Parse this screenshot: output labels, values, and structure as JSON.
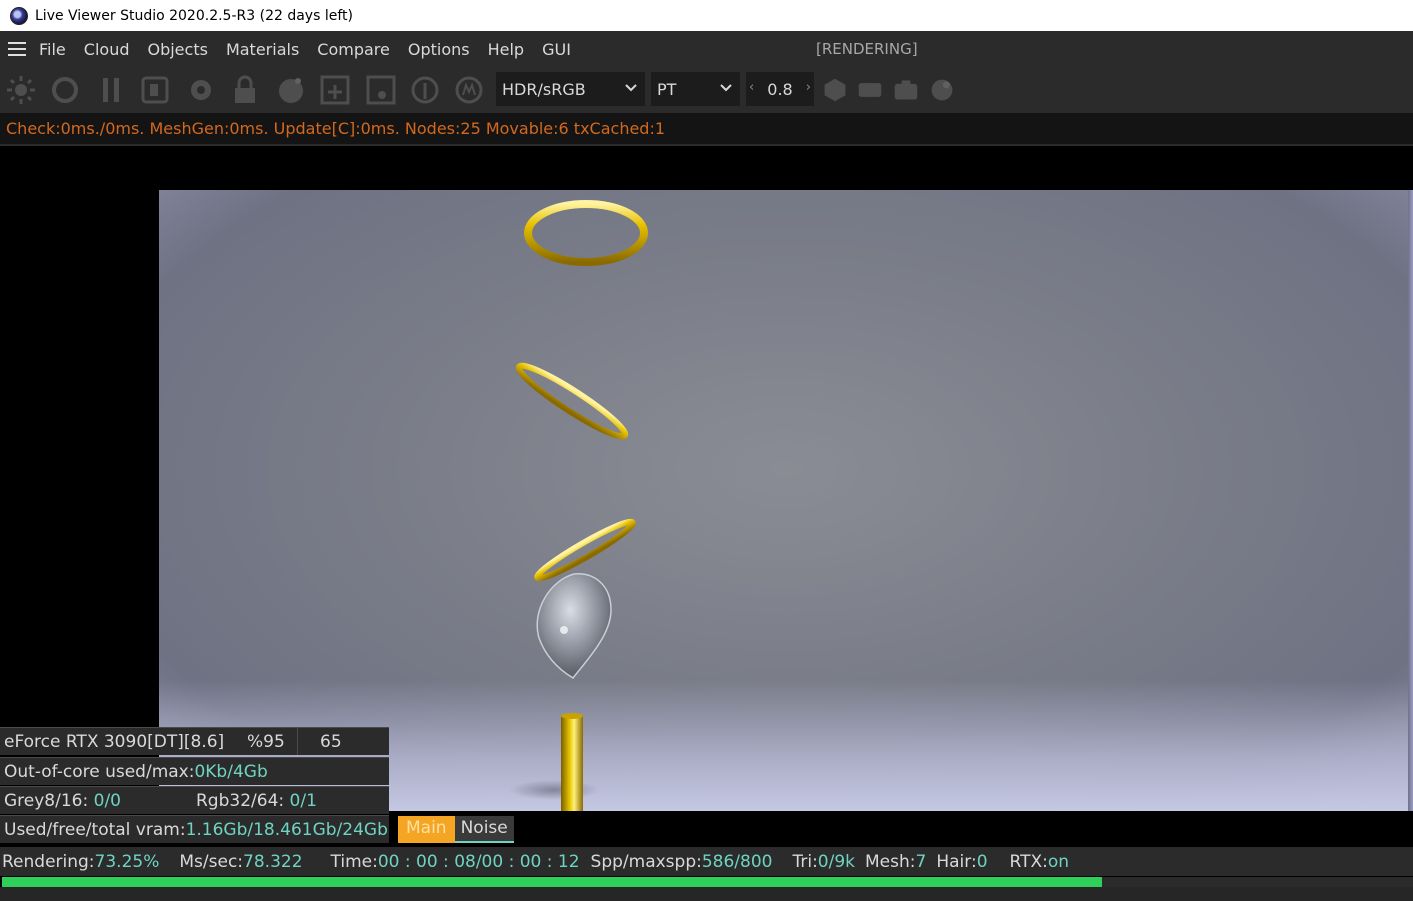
{
  "window": {
    "title": "Live Viewer Studio 2020.2.5-R3 (22 days left)"
  },
  "menu": {
    "items": [
      "File",
      "Cloud",
      "Objects",
      "Materials",
      "Compare",
      "Options",
      "Help",
      "GUI"
    ],
    "status": "[RENDERING]"
  },
  "toolbar": {
    "icons": [
      "sun-icon",
      "refresh-icon",
      "pause-icon",
      "region-icon",
      "settings-icon",
      "lock-icon",
      "sphere-icon",
      "add-icon",
      "focus-icon",
      "pick-icon",
      "material-icon"
    ],
    "color_space": "HDR/sRGB",
    "kernel": "PT",
    "value": "0.8",
    "right_icons": [
      "hexagon-icon",
      "film-icon",
      "camera-icon",
      "shading-icon"
    ]
  },
  "stats_line": "Check:0ms./0ms. MeshGen:0ms. Update[C]:0ms. Nodes:25 Movable:6 txCached:1",
  "gpu": {
    "name": "eForce RTX 3090[DT][8.6]",
    "usage": "%95",
    "temp": "65"
  },
  "outofcore": {
    "label": "Out-of-core used/max:",
    "value": "0Kb/4Gb"
  },
  "textures": {
    "grey_label": "Grey8/16: ",
    "grey_value": "0/0",
    "rgb_label": "Rgb32/64: ",
    "rgb_value": "0/1"
  },
  "vram": {
    "label": "Used/free/total vram: ",
    "value": "1.16Gb/18.461Gb/24Gb"
  },
  "tabs": {
    "main": "Main",
    "noise": "Noise"
  },
  "status": {
    "rendering_label": "Rendering: ",
    "rendering_value": "73.25%",
    "ms_label": "Ms/sec: ",
    "ms_value": "78.322",
    "time_label": "Time: ",
    "time_value": "00 : 00 : 08/00 : 00 : 12",
    "spp_label": "Spp/maxspp: ",
    "spp_value": "586/800",
    "tri_label": "Tri: ",
    "tri_value": "0/9k",
    "mesh_label": "Mesh: ",
    "mesh_value": "7",
    "hair_label": "Hair: ",
    "hair_value": "0",
    "rtx_label": "RTX:",
    "rtx_value": "on"
  },
  "progress": 0.7325,
  "colors": {
    "accent_teal": "#6fd3c2",
    "stats_orange": "#d2691e",
    "progress_green": "#2ed05a",
    "tab_orange": "#f5a524",
    "gold": "#e8c200"
  }
}
